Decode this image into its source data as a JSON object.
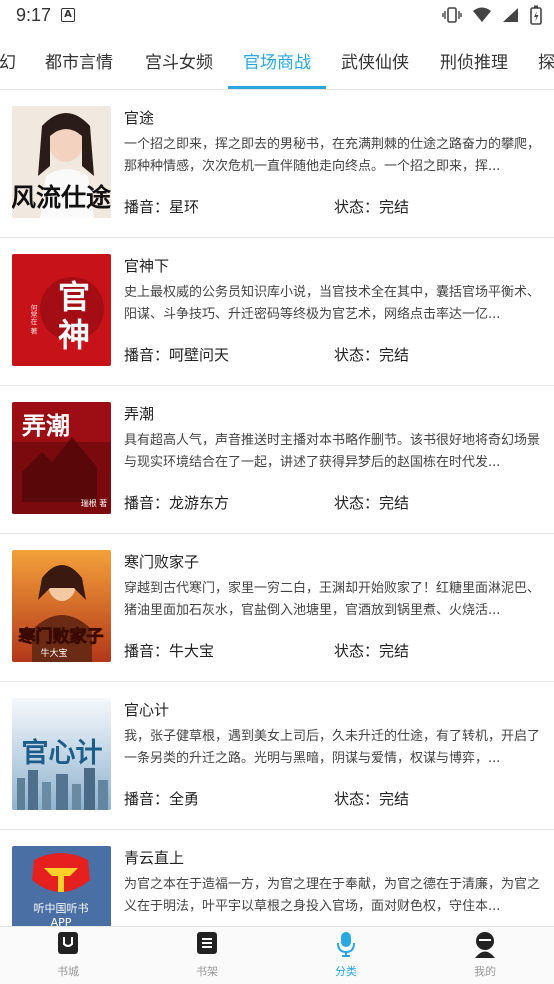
{
  "status_bar": {
    "time": "9:17",
    "badge": "A"
  },
  "tabs": [
    {
      "label": "幻"
    },
    {
      "label": "都市言情"
    },
    {
      "label": "宫斗女频"
    },
    {
      "label": "官场商战"
    },
    {
      "label": "武侠仙侠"
    },
    {
      "label": "刑侦推理"
    },
    {
      "label": "探"
    }
  ],
  "active_tab": "官场商战",
  "books": [
    {
      "title": "官途",
      "desc": "一个招之即来，挥之即去的男秘书，在充满荆棘的仕途之路奋力的攀爬，那种种情感，次次危机一直伴随他走向终点。一个招之即来，挥...",
      "narrator": "播音：星环",
      "status": "状态：完结",
      "cover_text": "风流仕途",
      "cover_bg": "#efe6dc",
      "cover_fg": "#111111"
    },
    {
      "title": "官神下",
      "desc": "史上最权威的公务员知识库小说，当官技术全在其中，囊括官场平衡术、阳谋、斗争技巧、升迁密码等终极为官艺术，网络点击率达一亿...",
      "narrator": "播音：呵壁问天",
      "status": "状态：完结",
      "cover_text": "官神",
      "cover_bg": "#c8121a",
      "cover_fg": "#ffffff"
    },
    {
      "title": "弄潮",
      "desc": "具有超高人气，声音推送时主播对本书略作删节。该书很好地将奇幻场景与现实环境结合在了一起，讲述了获得异梦后的赵国栋在时代发...",
      "narrator": "播音：龙游东方",
      "status": "状态：完结",
      "cover_text": "弄潮",
      "cover_bg": "#a80f14",
      "cover_fg": "#ffffff"
    },
    {
      "title": "寒门败家子",
      "desc": "穿越到古代寒门，家里一穷二白，王渊却开始败家了！红糖里面淋泥巴、猪油里面加石灰水，官盐倒入池塘里，官酒放到锅里煮、火烧活...",
      "narrator": "播音：牛大宝",
      "status": "状态：完结",
      "cover_text": "寒门败家子",
      "cover_bg": "#d0661e",
      "cover_fg": "#ffe9a0"
    },
    {
      "title": "官心计",
      "desc": "我，张子健草根，遇到美女上司后，久未升迁的仕途，有了转机，开启了一条另类的升迁之路。光明与黑暗，阴谋与爱情，权谋与博弈，...",
      "narrator": "播音：全勇",
      "status": "状态：完结",
      "cover_text": "官心计",
      "cover_bg": "#dce8f0",
      "cover_fg": "#1d5d8a"
    },
    {
      "title": "青云直上",
      "desc": "为官之本在于造福一方，为官之理在于奉献，为官之德在于清廉，为官之义在于明法，叶平宇以草根之身投入官场，面对财色权，守住本...",
      "narrator": "",
      "status": "",
      "cover_text": "听中国听书APP",
      "cover_bg": "#4a6fa5",
      "cover_fg": "#ffffff"
    }
  ],
  "bottom_nav": [
    {
      "label": "书城",
      "icon": "bookstore-icon"
    },
    {
      "label": "书架",
      "icon": "bookshelf-icon"
    },
    {
      "label": "分类",
      "icon": "microphone-icon",
      "active": true
    },
    {
      "label": "我的",
      "icon": "profile-icon"
    }
  ],
  "colors": {
    "accent": "#2aa7e0",
    "divider": "#e8e8e8"
  }
}
